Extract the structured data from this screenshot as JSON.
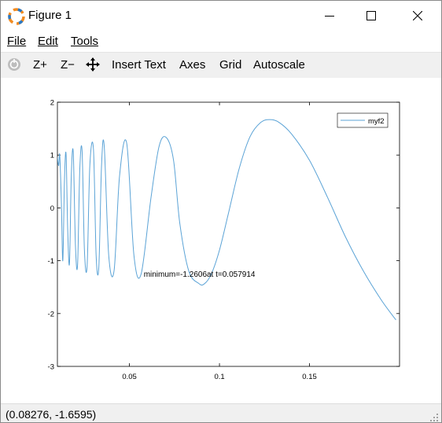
{
  "window": {
    "title": "Figure 1"
  },
  "menu": {
    "file": "File",
    "edit": "Edit",
    "tools": "Tools"
  },
  "toolbar": {
    "zoom_in": "Z+",
    "zoom_out": "Z−",
    "insert_text": "Insert Text",
    "axes": "Axes",
    "grid": "Grid",
    "autoscale": "Autoscale"
  },
  "status": {
    "coordinates": "(0.08276, -1.6595)"
  },
  "chart_data": {
    "type": "line",
    "series": [
      {
        "name": "myf2",
        "color": "#5ba3d6",
        "points": [
          [
            0.01,
            0.96
          ],
          [
            0.0107,
            0.8
          ],
          [
            0.0113,
            1.0
          ],
          [
            0.0122,
            0.1
          ],
          [
            0.013,
            -1.0
          ],
          [
            0.0139,
            0.5
          ],
          [
            0.0148,
            1.02
          ],
          [
            0.0157,
            -0.4
          ],
          [
            0.0167,
            -1.05
          ],
          [
            0.0177,
            0.6
          ],
          [
            0.0188,
            1.05
          ],
          [
            0.02,
            -0.7
          ],
          [
            0.0212,
            -1.08
          ],
          [
            0.0224,
            0.7
          ],
          [
            0.0237,
            1.08
          ],
          [
            0.025,
            -0.8
          ],
          [
            0.0265,
            -1.1
          ],
          [
            0.028,
            0.8
          ],
          [
            0.03,
            1.12
          ],
          [
            0.0315,
            -0.9
          ],
          [
            0.033,
            -1.12
          ],
          [
            0.0345,
            0.8
          ],
          [
            0.036,
            1.17
          ],
          [
            0.0385,
            -0.9
          ],
          [
            0.0415,
            -1.18
          ],
          [
            0.0445,
            0.6
          ],
          [
            0.0485,
            1.22
          ],
          [
            0.0525,
            -0.9
          ],
          [
            0.0565,
            -1.25
          ],
          [
            0.062,
            0.2
          ],
          [
            0.0665,
            1.17
          ],
          [
            0.0705,
            1.33
          ],
          [
            0.0745,
            0.9
          ],
          [
            0.078,
            -0.3
          ],
          [
            0.083,
            -1.2
          ],
          [
            0.0885,
            -1.43
          ],
          [
            0.0915,
            -1.44
          ],
          [
            0.0955,
            -1.25
          ],
          [
            0.1,
            -0.8
          ],
          [
            0.105,
            -0.1
          ],
          [
            0.111,
            0.75
          ],
          [
            0.117,
            1.35
          ],
          [
            0.123,
            1.62
          ],
          [
            0.128,
            1.67
          ],
          [
            0.133,
            1.62
          ],
          [
            0.14,
            1.4
          ],
          [
            0.15,
            0.9
          ],
          [
            0.16,
            0.2
          ],
          [
            0.17,
            -0.55
          ],
          [
            0.18,
            -1.2
          ],
          [
            0.19,
            -1.75
          ],
          [
            0.198,
            -2.12
          ]
        ]
      }
    ],
    "xlim": [
      0.01,
      0.2
    ],
    "ylim": [
      -3,
      2
    ],
    "xticks": [
      0.05,
      0.1,
      0.15
    ],
    "xtick_labels": [
      "0.05",
      "0.1",
      "0.15"
    ],
    "yticks": [
      2,
      1,
      0,
      -1,
      -2,
      -3
    ],
    "ytick_labels": [
      "2",
      "1",
      "0",
      "-1",
      "-2",
      "-3"
    ],
    "annotation": {
      "text": "minimum=-1.2606at t=0.057914",
      "x": 0.057914,
      "y": -1.2606
    },
    "legend_position": "top-right",
    "grid": false
  }
}
